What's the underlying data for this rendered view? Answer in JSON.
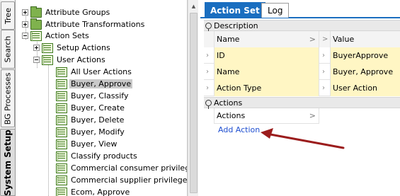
{
  "vertical_tabs": [
    {
      "label": "Tree",
      "active": false
    },
    {
      "label": "Search",
      "active": false
    },
    {
      "label": "BG Processes",
      "active": false
    },
    {
      "label": "System Setup",
      "active": true
    }
  ],
  "tree": {
    "items": [
      {
        "label": "Attribute Groups",
        "icon": "folder-icon",
        "expander": "plus"
      },
      {
        "label": "Attribute Transformations",
        "icon": "folder-icon",
        "expander": "plus"
      },
      {
        "label": "Action Sets",
        "icon": "action-set-icon",
        "expander": "minus"
      },
      {
        "label": "Setup Actions",
        "icon": "action-set-icon",
        "expander": "plus"
      },
      {
        "label": "User Actions",
        "icon": "action-set-icon",
        "expander": "minus"
      },
      {
        "label": "All User Actions",
        "icon": "action-set-icon"
      },
      {
        "label": "Buyer, Approve",
        "icon": "action-set-icon",
        "selected": true
      },
      {
        "label": "Buyer, Classify",
        "icon": "action-set-icon"
      },
      {
        "label": "Buyer, Create",
        "icon": "action-set-icon"
      },
      {
        "label": "Buyer, Delete",
        "icon": "action-set-icon"
      },
      {
        "label": "Buyer, Modify",
        "icon": "action-set-icon"
      },
      {
        "label": "Buyer, View",
        "icon": "action-set-icon"
      },
      {
        "label": "Classify products",
        "icon": "action-set-icon"
      },
      {
        "label": "Commercial consumer privileges",
        "icon": "action-set-icon"
      },
      {
        "label": "Commercial supplier privileges",
        "icon": "action-set-icon"
      },
      {
        "label": "Ecom, Approve",
        "icon": "action-set-icon"
      }
    ]
  },
  "panel": {
    "tabs": [
      {
        "label": "Action Set",
        "active": true
      },
      {
        "label": "Log",
        "active": false
      }
    ],
    "description": {
      "title": "Description",
      "header": {
        "name": "Name",
        "value": "Value"
      },
      "rows": [
        {
          "name": "ID",
          "value": "BuyerApprove"
        },
        {
          "name": "Name",
          "value": "Buyer, Approve"
        },
        {
          "name": "Action Type",
          "value": "User Action"
        }
      ]
    },
    "actions": {
      "title": "Actions",
      "header": "Actions",
      "add_link": "Add Action"
    }
  },
  "colors": {
    "accent": "#1a6ec0",
    "highlight_row": "#fff6c4",
    "annotation_arrow": "#9b1c1c"
  }
}
